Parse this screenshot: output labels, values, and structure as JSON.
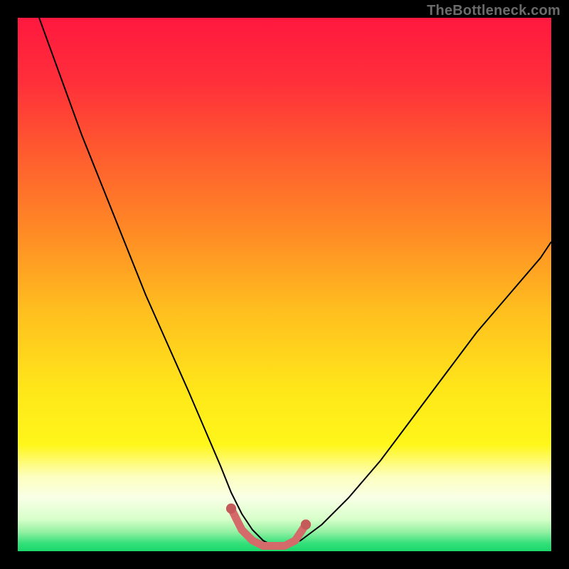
{
  "watermark": "TheBottleneck.com",
  "colors": {
    "background": "#000000",
    "curve": "#000000",
    "highlight": "#d46a6a",
    "highlight_dot": "#c45a5a"
  },
  "chart_data": {
    "type": "line",
    "title": "",
    "xlabel": "",
    "ylabel": "",
    "xlim": [
      0,
      100
    ],
    "ylim": [
      0,
      100
    ],
    "grid": false,
    "legend": false,
    "gradient_stops": [
      {
        "offset": 0.0,
        "color": "#ff183f"
      },
      {
        "offset": 0.12,
        "color": "#ff2f3a"
      },
      {
        "offset": 0.25,
        "color": "#ff5a2f"
      },
      {
        "offset": 0.4,
        "color": "#ff8a25"
      },
      {
        "offset": 0.55,
        "color": "#ffbf1f"
      },
      {
        "offset": 0.7,
        "color": "#ffe71a"
      },
      {
        "offset": 0.8,
        "color": "#fff61a"
      },
      {
        "offset": 0.86,
        "color": "#fdffbf"
      },
      {
        "offset": 0.9,
        "color": "#f8ffe6"
      },
      {
        "offset": 0.94,
        "color": "#d8ffca"
      },
      {
        "offset": 0.965,
        "color": "#8ff0a0"
      },
      {
        "offset": 0.985,
        "color": "#35e07a"
      },
      {
        "offset": 1.0,
        "color": "#19d86a"
      }
    ],
    "series": [
      {
        "name": "bottleneck-curve",
        "x": [
          4,
          8,
          12,
          16,
          20,
          24,
          28,
          32,
          35,
          38,
          40,
          42,
          44,
          46,
          48,
          50,
          53,
          57,
          62,
          68,
          74,
          80,
          86,
          92,
          98,
          100
        ],
        "y": [
          100,
          89,
          78,
          68,
          58,
          48,
          39,
          30,
          23,
          16,
          11,
          7,
          4,
          2,
          1,
          1,
          2,
          5,
          10,
          17,
          25,
          33,
          41,
          48,
          55,
          58
        ]
      }
    ],
    "highlight_region": {
      "name": "optimal-zone",
      "x": [
        40,
        42,
        44,
        46,
        48,
        50,
        52,
        54
      ],
      "y": [
        8,
        4,
        2,
        1,
        1,
        1,
        2,
        5
      ]
    }
  }
}
